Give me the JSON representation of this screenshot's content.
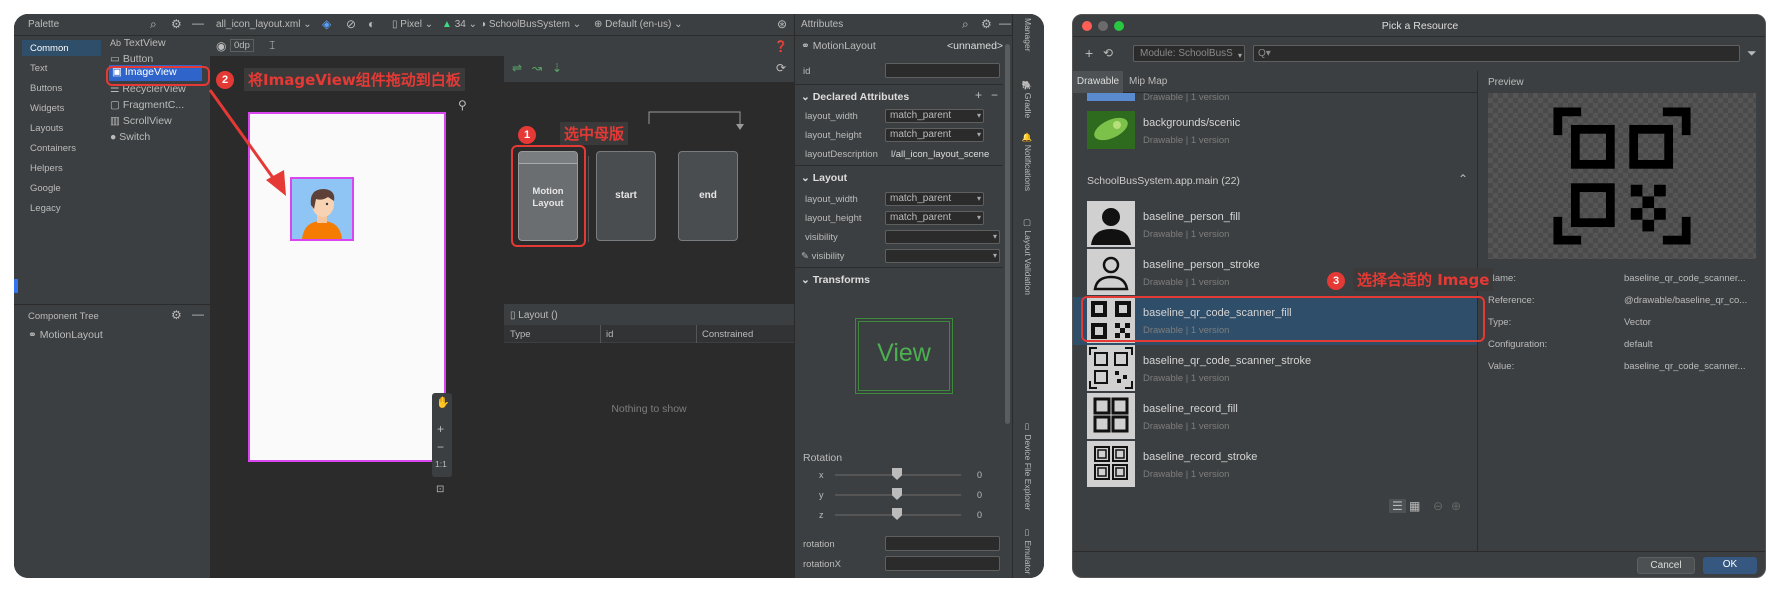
{
  "palette": {
    "title": "Palette",
    "categories": [
      "Common",
      "Text",
      "Buttons",
      "Widgets",
      "Layouts",
      "Containers",
      "Helpers",
      "Google",
      "Legacy"
    ],
    "selected": "Common",
    "widgets": [
      {
        "icon": "Ab",
        "label": "TextView"
      },
      {
        "icon": "▭",
        "label": "Button"
      },
      {
        "icon": "▣",
        "label": "ImageView"
      },
      {
        "icon": "☰",
        "label": "RecyclerView"
      },
      {
        "icon": "▢",
        "label": "FragmentC..."
      },
      {
        "icon": "▥",
        "label": "ScrollView"
      },
      {
        "icon": "●",
        "label": "Switch"
      }
    ]
  },
  "component_tree": {
    "title": "Component Tree",
    "root": "MotionLayout"
  },
  "toolbar": {
    "file": "all_icon_layout.xml",
    "device": "Pixel",
    "api": "34",
    "app": "SchoolBusSystem",
    "locale": "Default (en-us)",
    "margin": "0dp"
  },
  "annotations": {
    "a1_num": "1",
    "a1_text": "选中母版",
    "a2_num": "2",
    "a2_text": "将ImageView组件拖动到白板",
    "a3_num": "3",
    "a3_text": "选择合适的 Image"
  },
  "motion": {
    "parent": "Motion Layout",
    "start": "start",
    "end": "end"
  },
  "zoom": {
    "ratio": "1:1"
  },
  "layout_panel": {
    "title": "Layout ()",
    "cols": [
      "Type",
      "id",
      "Constrained"
    ],
    "empty": "Nothing to show"
  },
  "attributes": {
    "title": "Attributes",
    "widget": "MotionLayout",
    "unnamed": "<unnamed>",
    "id_label": "id",
    "declared_title": "Declared Attributes",
    "declared": [
      {
        "k": "layout_width",
        "v": "match_parent"
      },
      {
        "k": "layout_height",
        "v": "match_parent"
      },
      {
        "k": "layoutDescription",
        "v": "l/all_icon_layout_scene"
      }
    ],
    "layout_title": "Layout",
    "layout": [
      {
        "k": "layout_width",
        "v": "match_parent"
      },
      {
        "k": "layout_height",
        "v": "match_parent"
      },
      {
        "k": "visibility",
        "v": ""
      },
      {
        "k": "visibility",
        "v": ""
      }
    ],
    "transforms_title": "Transforms",
    "view_preview": "View",
    "rotation_title": "Rotation",
    "rot": [
      {
        "k": "x",
        "v": "0"
      },
      {
        "k": "y",
        "v": "0"
      },
      {
        "k": "z",
        "v": "0"
      }
    ],
    "bottom": [
      {
        "k": "rotation"
      },
      {
        "k": "rotationX"
      }
    ]
  },
  "side_tabs": [
    "Gradle",
    "Notifications",
    "Layout Validation",
    "Device File Explorer",
    "Emulator"
  ],
  "side_tabs_left": [
    "Manager"
  ],
  "pick": {
    "title": "Pick a Resource",
    "module": "Module: SchoolBusS",
    "search_placeholder": "Q▾",
    "tabs": [
      "Drawable",
      "Mip Map"
    ],
    "top_item": {
      "name": "",
      "sub": "Drawable",
      "ver": "1 version"
    },
    "scenic": {
      "name": "backgrounds/scenic",
      "sub": "Drawable",
      "ver": "1 version"
    },
    "group": "SchoolBusSystem.app.main (22)",
    "items": [
      {
        "name": "baseline_person_fill",
        "sub": "Drawable",
        "ver": "1 version",
        "icon": "person-fill-icon"
      },
      {
        "name": "baseline_person_stroke",
        "sub": "Drawable",
        "ver": "1 version",
        "icon": "person-stroke-icon"
      },
      {
        "name": "baseline_qr_code_scanner_fill",
        "sub": "Drawable",
        "ver": "1 version",
        "icon": "qr-fill-icon"
      },
      {
        "name": "baseline_qr_code_scanner_stroke",
        "sub": "Drawable",
        "ver": "1 version",
        "icon": "qr-stroke-icon"
      },
      {
        "name": "baseline_record_fill",
        "sub": "Drawable",
        "ver": "1 version",
        "icon": "record-fill-icon"
      },
      {
        "name": "baseline_record_stroke",
        "sub": "Drawable",
        "ver": "1 version",
        "icon": "record-stroke-icon"
      }
    ],
    "preview": "Preview",
    "details": [
      {
        "k": "Name:",
        "v": "baseline_qr_code_scanner..."
      },
      {
        "k": "Reference:",
        "v": "@drawable/baseline_qr_co..."
      },
      {
        "k": "Type:",
        "v": "Vector"
      },
      {
        "k": "Configuration:",
        "v": "default"
      },
      {
        "k": "Value:",
        "v": "baseline_qr_code_scanner..."
      }
    ],
    "cancel": "Cancel",
    "ok": "OK"
  },
  "colors": {
    "accent": "#e53935",
    "blue": "#3574f0",
    "magenta": "#d946ef"
  }
}
